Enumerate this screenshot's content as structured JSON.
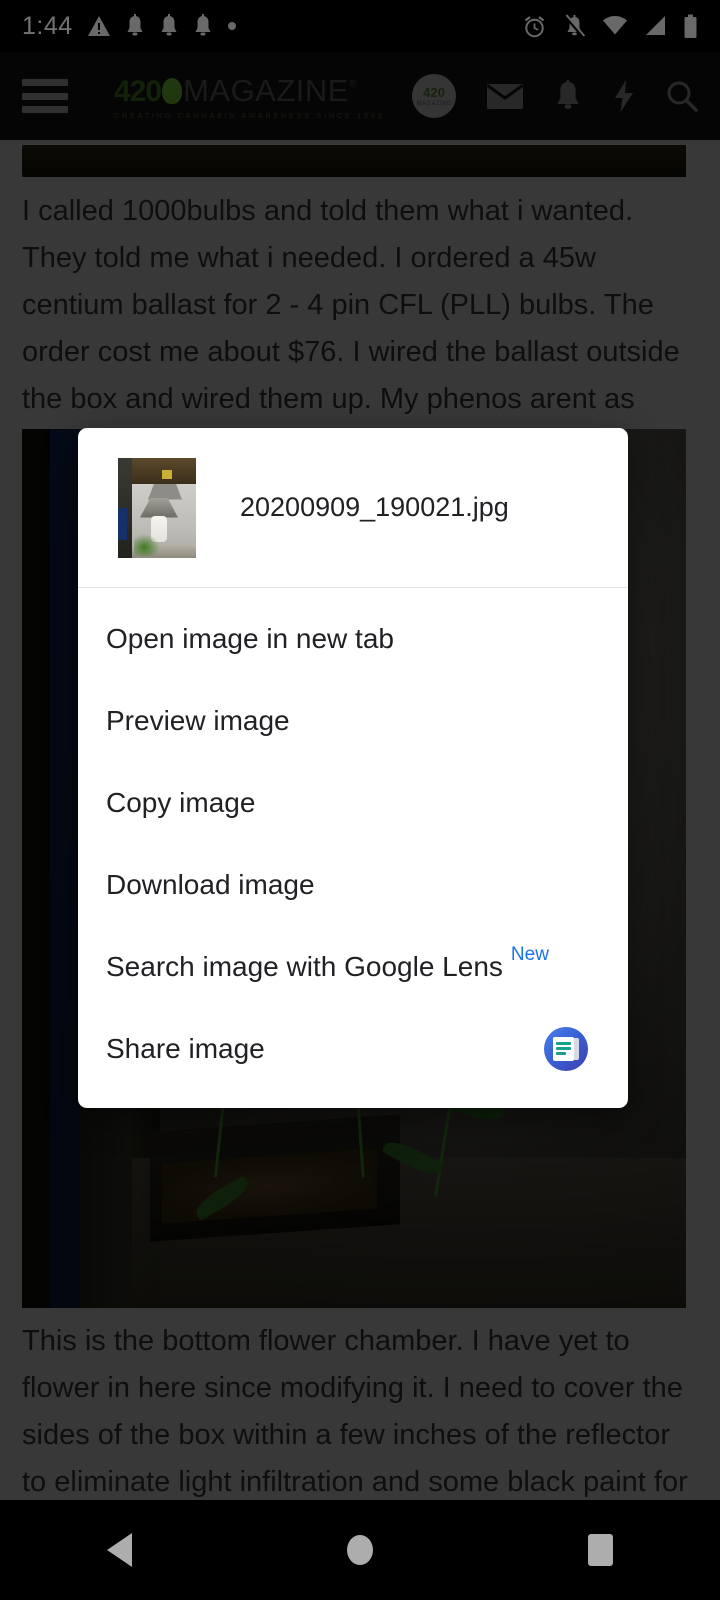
{
  "status_bar": {
    "time": "1:44",
    "left_icons": [
      "warning-triangle-icon",
      "notification-bell-icon",
      "notification-bell-icon",
      "notification-bell-icon",
      "dot-icon"
    ],
    "right_icons": [
      "alarm-clock-icon",
      "bell-muted-icon",
      "wifi-icon",
      "cell-signal-icon",
      "battery-icon"
    ]
  },
  "app_bar": {
    "menu_icon": "hamburger-menu-icon",
    "brand_number": "420",
    "brand_word": "MAGAZINE",
    "brand_registered": "®",
    "brand_tagline": "CREATING CANNABIS AWARENESS SINCE 1993",
    "avatar_top": "420",
    "avatar_bottom": "MAGAZINE",
    "actions": [
      "mail-icon",
      "bell-icon",
      "lightning-bolt-icon",
      "search-icon"
    ]
  },
  "page": {
    "paragraph_1": "I called 1000bulbs and told them what i wanted. They told me what i needed. I ordered a 45w centium ballast for 2 - 4 pin CFL (PLL) bulbs. The order cost me about $76. I wired the ballast outside the box and wired them up. My phenos arent as healthy as possible. I haven't kept up on my trims, but they are fed. They are past due for annual root trim that i have yet to ever do.",
    "paragraph_2": "This is the bottom flower chamber. I have yet to flower in here since modifying it. I need to cover the sides of the box within a few inches of the reflector to eliminate light infiltration and some black paint for the sides. This section is currently helping along some new"
  },
  "context_menu": {
    "filename": "20200909_190021.jpg",
    "thumbnail_alt": "grow-box-reflector-thumbnail",
    "items": [
      {
        "label": "Open image in new tab",
        "badge": "",
        "trailing_icon": ""
      },
      {
        "label": "Preview image",
        "badge": "",
        "trailing_icon": ""
      },
      {
        "label": "Copy image",
        "badge": "",
        "trailing_icon": ""
      },
      {
        "label": "Download image",
        "badge": "",
        "trailing_icon": ""
      },
      {
        "label": "Search image with Google Lens",
        "badge": "New",
        "trailing_icon": ""
      },
      {
        "label": "Share image",
        "badge": "",
        "trailing_icon": "messages-app-icon"
      }
    ]
  },
  "nav_bar": {
    "back": "back-button",
    "home": "home-button",
    "recents": "recents-button"
  },
  "colors": {
    "accent_blue": "#1a73e8",
    "dialog_bg": "#ffffff",
    "text_primary": "#202124",
    "page_bg": "#7d7d7d",
    "brand_green": "#4b7a22"
  }
}
